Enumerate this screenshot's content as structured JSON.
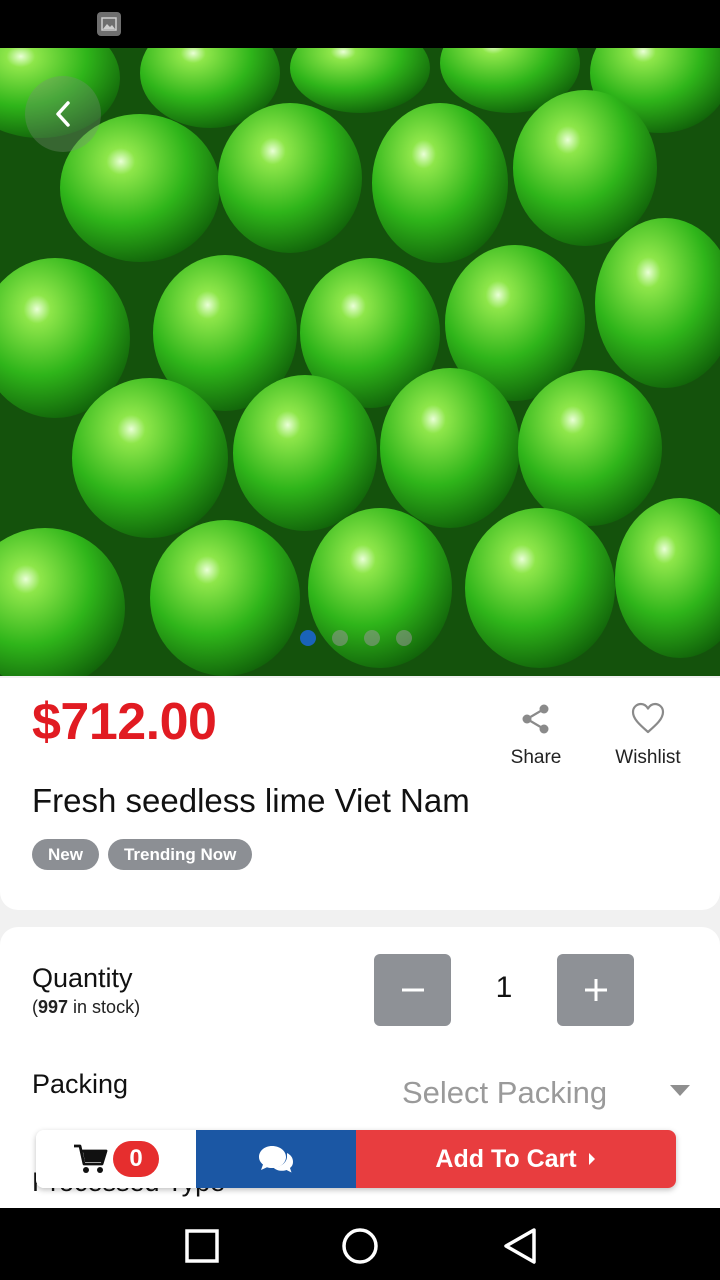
{
  "product": {
    "price": "$712.00",
    "title": "Fresh seedless lime Viet Nam",
    "badges": [
      "New",
      "Trending Now"
    ],
    "image_count": 4,
    "active_image": 1
  },
  "actions": {
    "share_label": "Share",
    "wishlist_label": "Wishlist"
  },
  "quantity": {
    "label": "Quantity",
    "stock_count": "997",
    "stock_suffix": " in stock)",
    "stock_prefix": "(",
    "value": "1"
  },
  "packing": {
    "label": "Packing",
    "placeholder": "Select Packing"
  },
  "processed_type": {
    "label": "Processed Type"
  },
  "cart_bar": {
    "cart_count": "0",
    "add_to_cart_label": "Add To Cart"
  },
  "colors": {
    "price": "#e11b22",
    "accent_blue": "#1b57a4",
    "add_to_cart": "#e83d3f",
    "badge": "#8c8f94"
  },
  "icons": [
    "image-icon",
    "back-arrow-icon",
    "share-icon",
    "heart-icon",
    "minus-icon",
    "plus-icon",
    "cart-icon",
    "chat-icon",
    "caret-right-icon",
    "nav-back-icon",
    "nav-home-icon",
    "nav-recents-icon"
  ]
}
